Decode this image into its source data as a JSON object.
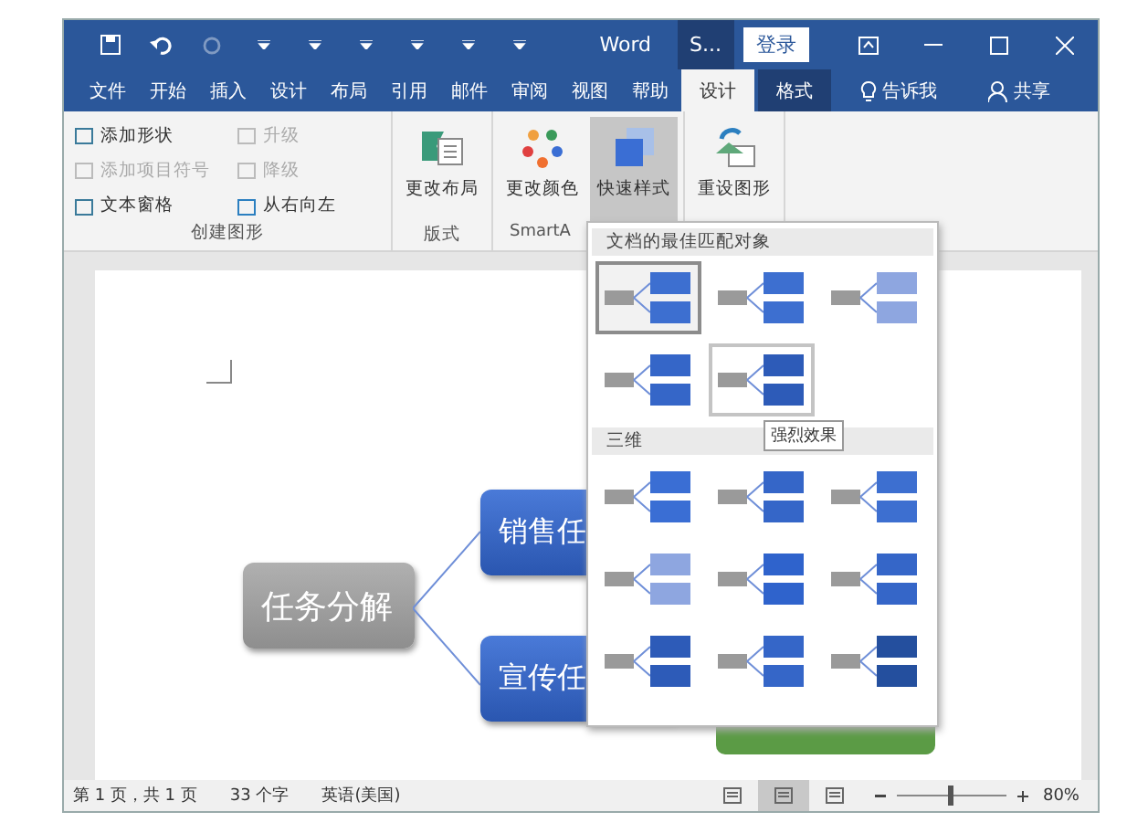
{
  "title_bar": {
    "app_title": "Word",
    "context_title": "S...",
    "login_button": "登录"
  },
  "menu_tabs": [
    {
      "label": "文件",
      "selected": false,
      "kind": "normal"
    },
    {
      "label": "开始",
      "selected": false,
      "kind": "normal"
    },
    {
      "label": "插入",
      "selected": false,
      "kind": "normal"
    },
    {
      "label": "设计",
      "selected": false,
      "kind": "normal"
    },
    {
      "label": "布局",
      "selected": false,
      "kind": "normal"
    },
    {
      "label": "引用",
      "selected": false,
      "kind": "normal"
    },
    {
      "label": "邮件",
      "selected": false,
      "kind": "normal"
    },
    {
      "label": "审阅",
      "selected": false,
      "kind": "normal"
    },
    {
      "label": "视图",
      "selected": false,
      "kind": "normal"
    },
    {
      "label": "帮助",
      "selected": false,
      "kind": "normal"
    },
    {
      "label": "设计",
      "selected": true,
      "kind": "context"
    },
    {
      "label": "格式",
      "selected": false,
      "kind": "context"
    }
  ],
  "tell_me": "告诉我",
  "share": "共享",
  "ribbon": {
    "create_graphic": {
      "label": "创建图形",
      "items": [
        {
          "label": "添加形状",
          "disabled": false
        },
        {
          "label": "升级",
          "disabled": true
        },
        {
          "label": "添加项目符号",
          "disabled": true
        },
        {
          "label": "降级",
          "disabled": true
        },
        {
          "label": "文本窗格",
          "disabled": false
        },
        {
          "label": "从右向左",
          "disabled": false
        }
      ]
    },
    "groups": [
      {
        "label": "版式",
        "buttons": [
          {
            "label": "更改布局",
            "selected": false
          }
        ]
      },
      {
        "label": "SmartA",
        "buttons": [
          {
            "label": "更改颜色",
            "selected": false
          },
          {
            "label": "快速样式",
            "selected": true
          }
        ]
      },
      {
        "buttons": [
          {
            "label": "重设图形",
            "selected": false
          }
        ]
      }
    ]
  },
  "style_gallery": {
    "sections": [
      {
        "title": "文档的最佳匹配对象",
        "items": [
          {
            "selected": true,
            "hovered": false,
            "color": "#3d6fd0"
          },
          {
            "selected": false,
            "hovered": false,
            "color": "#3d6fd0"
          },
          {
            "selected": false,
            "hovered": false,
            "color": "#8ea6e0"
          },
          {
            "selected": false,
            "hovered": false,
            "color": "#3566c8"
          },
          {
            "selected": false,
            "hovered": true,
            "color": "#2d5bb8"
          }
        ]
      },
      {
        "title": "三维",
        "items": [
          {
            "selected": false,
            "hovered": false,
            "color": "#3a6ed4"
          },
          {
            "selected": false,
            "hovered": false,
            "color": "#3566c8"
          },
          {
            "selected": false,
            "hovered": false,
            "color": "#3d6fd0"
          },
          {
            "selected": false,
            "hovered": false,
            "color": "#8ea6e0"
          },
          {
            "selected": false,
            "hovered": false,
            "color": "#2f63cc"
          },
          {
            "selected": false,
            "hovered": false,
            "color": "#3566c8"
          },
          {
            "selected": false,
            "hovered": false,
            "color": "#2d5bb8"
          },
          {
            "selected": false,
            "hovered": false,
            "color": "#3566c8"
          },
          {
            "selected": false,
            "hovered": false,
            "color": "#244f9e"
          }
        ]
      }
    ],
    "tooltip": "强烈效果"
  },
  "diagram": {
    "root": "任务分解",
    "children": [
      "销售任",
      "宣传任"
    ]
  },
  "status_bar": {
    "page": "第 1 页，共 1 页",
    "words": "33 个字",
    "language": "英语(美国)",
    "views": [
      {
        "selected": false
      },
      {
        "selected": true
      },
      {
        "selected": false
      }
    ],
    "zoom_slider": {
      "level": 0.5
    },
    "zoom": "80%"
  }
}
